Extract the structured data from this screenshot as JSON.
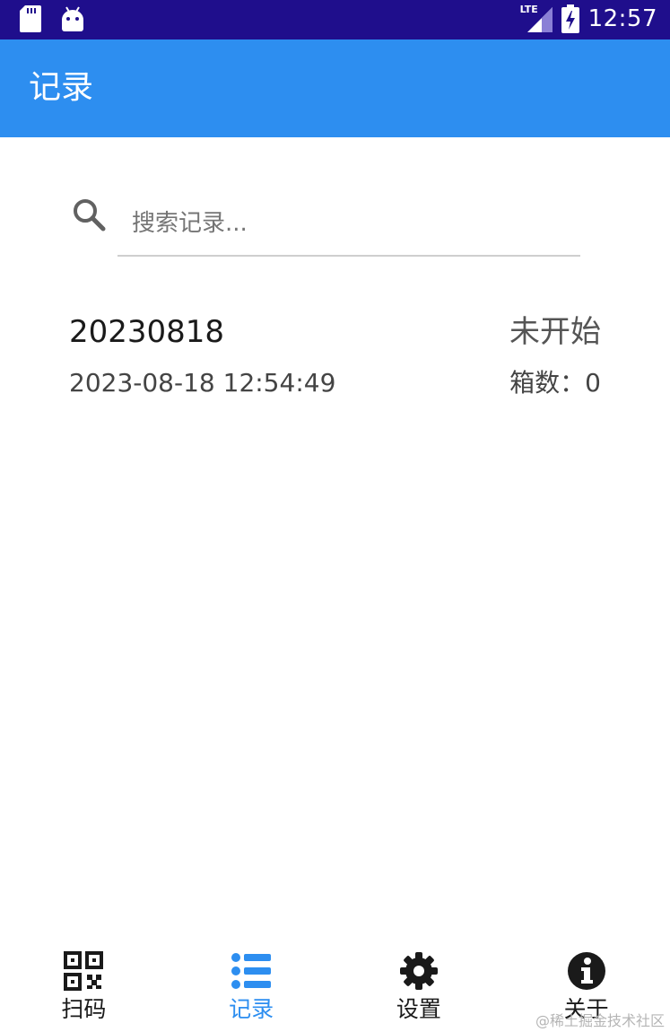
{
  "status_bar": {
    "time": "12:57",
    "network": "LTE",
    "icons": [
      "sd-card-icon",
      "android-icon",
      "lte-signal-icon",
      "battery-charging-icon"
    ]
  },
  "app_bar": {
    "title": "记录"
  },
  "search": {
    "placeholder": "搜索记录..."
  },
  "records": [
    {
      "name": "20230818",
      "datetime": "2023-08-18 12:54:49",
      "status": "未开始",
      "count_label": "箱数：0"
    }
  ],
  "bottom_nav": {
    "active_index": 1,
    "items": [
      {
        "label": "扫码",
        "icon": "qr-code-icon"
      },
      {
        "label": "记录",
        "icon": "list-icon"
      },
      {
        "label": "设置",
        "icon": "gear-icon"
      },
      {
        "label": "关于",
        "icon": "info-icon"
      }
    ]
  },
  "colors": {
    "status_bar": "#1f0e8c",
    "app_bar": "#2d8ef0",
    "active_nav": "#2d8ef0"
  },
  "watermark": "@稀土掘金技术社区"
}
